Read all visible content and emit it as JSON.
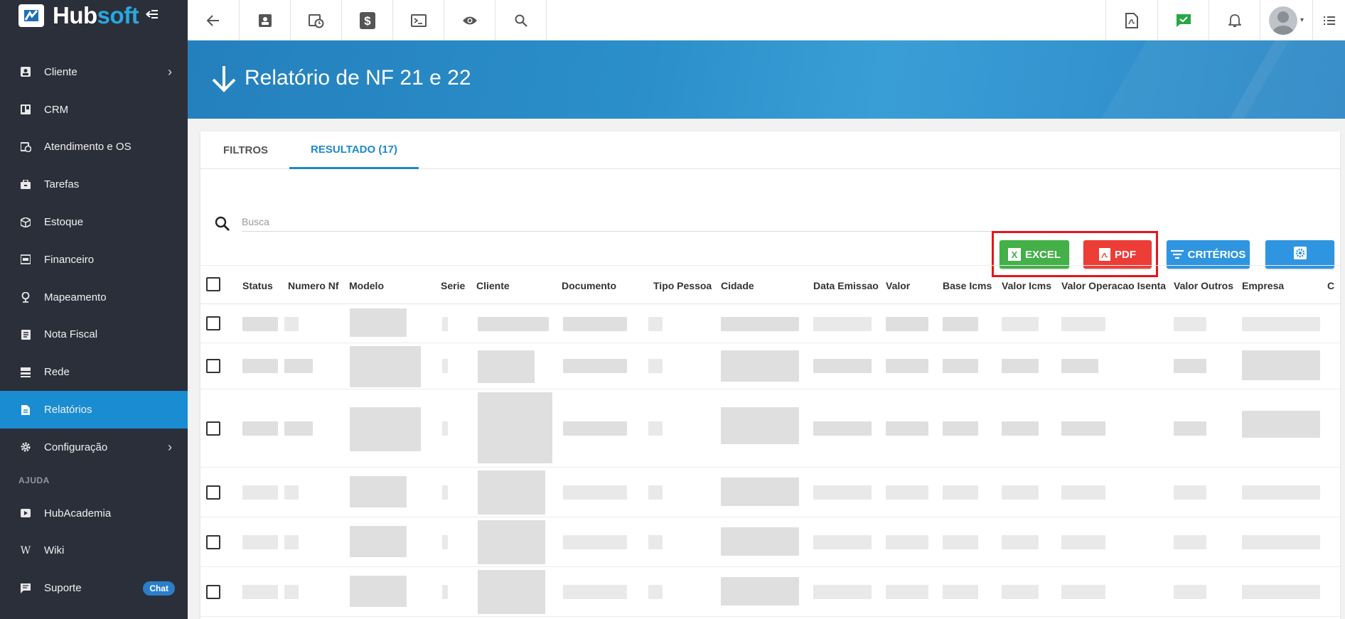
{
  "app": {
    "logo_hub": "Hub",
    "logo_soft": "soft"
  },
  "sidebar": {
    "items": [
      {
        "label": "Cliente",
        "icon": "contact-card-icon",
        "chevron": true
      },
      {
        "label": "CRM",
        "icon": "board-icon",
        "chevron": false
      },
      {
        "label": "Atendimento e OS",
        "icon": "calendar-clock-icon",
        "chevron": false
      },
      {
        "label": "Tarefas",
        "icon": "briefcase-icon",
        "chevron": false
      },
      {
        "label": "Estoque",
        "icon": "box-icon",
        "chevron": false
      },
      {
        "label": "Financeiro",
        "icon": "money-icon",
        "chevron": false
      },
      {
        "label": "Mapeamento",
        "icon": "map-pin-icon",
        "chevron": false
      },
      {
        "label": "Nota Fiscal",
        "icon": "invoice-icon",
        "chevron": false
      },
      {
        "label": "Rede",
        "icon": "server-icon",
        "chevron": false
      },
      {
        "label": "Relatórios",
        "icon": "report-icon",
        "chevron": false,
        "active": true
      },
      {
        "label": "Configuração",
        "icon": "gear-icon",
        "chevron": true
      }
    ],
    "section_help": "AJUDA",
    "help_items": [
      {
        "label": "HubAcademia",
        "icon": "play-icon"
      },
      {
        "label": "Wiki",
        "icon": "wiki-icon"
      },
      {
        "label": "Suporte",
        "icon": "chat-icon",
        "badge": "Chat"
      }
    ]
  },
  "banner": {
    "title": "Relatório de NF 21 e 22"
  },
  "tabs": [
    {
      "label": "FILTROS",
      "active": false
    },
    {
      "label": "RESULTADO (17)",
      "active": true
    }
  ],
  "search": {
    "placeholder": "Busca",
    "value": ""
  },
  "actions": {
    "excel_label": "EXCEL",
    "pdf_label": "PDF",
    "criteria_label": "CRITÉRIOS"
  },
  "table": {
    "columns": [
      "Status",
      "Numero Nf",
      "Modelo",
      "Serie",
      "Cliente",
      "Documento",
      "Tipo Pessoa",
      "Cidade",
      "Data Emissao",
      "Valor",
      "Base Icms",
      "Valor Icms",
      "Valor Operacao Isenta",
      "Valor Outros",
      "Empresa",
      "C"
    ]
  },
  "colors": {
    "sidebar_bg": "#2b2f3a",
    "accent": "#1a8cd2",
    "excel": "#43b048",
    "pdf": "#ec3d37",
    "criteria": "#2f95e0",
    "highlight": "#e8141c"
  }
}
